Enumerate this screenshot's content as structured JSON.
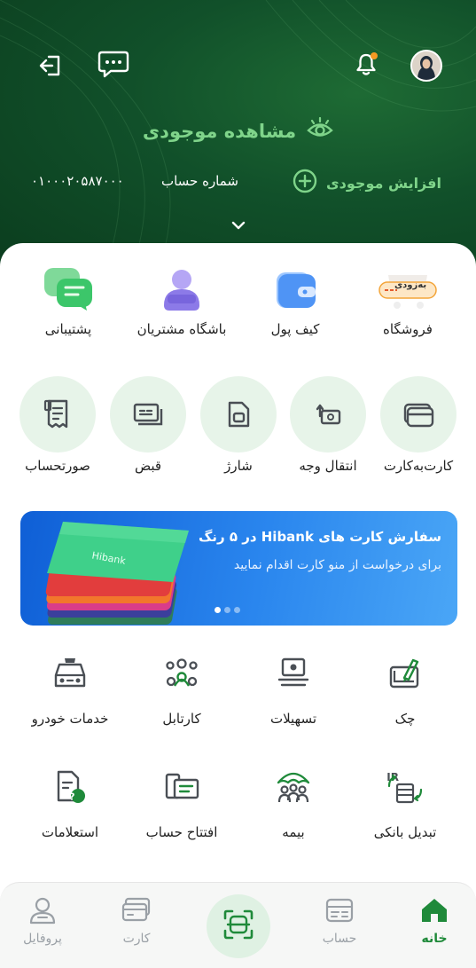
{
  "header": {
    "balance_title": "مشاهده موجودی",
    "account_label": "شماره حساب",
    "account_number": "۰۱۰۰۰۲۰۵۸۷۰۰۰",
    "increase_label": "افزایش موجودی"
  },
  "top_items": [
    {
      "label": "فروشگاه",
      "icon": "shop-icon",
      "badge": "به‌زودی"
    },
    {
      "label": "کیف پول",
      "icon": "wallet-icon"
    },
    {
      "label": "باشگاه مشتریان",
      "icon": "customer-club-icon"
    },
    {
      "label": "پشتیبانی",
      "icon": "support-chat-icon"
    }
  ],
  "circle_items": [
    {
      "label": "کارت‌به‌کارت",
      "icon": "card-to-card-icon"
    },
    {
      "label": "انتقال وجه",
      "icon": "money-transfer-icon"
    },
    {
      "label": "شارژ",
      "icon": "sim-charge-icon"
    },
    {
      "label": "قبض",
      "icon": "bill-icon"
    },
    {
      "label": "صورتحساب",
      "icon": "statement-icon"
    }
  ],
  "banner": {
    "title": "سفارش کارت های Hibank در ۵ رنگ",
    "subtitle": "برای درخواست از منو کارت اقدام نمایید",
    "card_text": "Hibank"
  },
  "services_row1": [
    {
      "label": "چک",
      "icon": "cheque-icon"
    },
    {
      "label": "تسهیلات",
      "icon": "loan-icon"
    },
    {
      "label": "کارتابل",
      "icon": "cartable-icon"
    },
    {
      "label": "خدمات خودرو",
      "icon": "car-services-icon"
    }
  ],
  "services_row2": [
    {
      "label": "تبدیل بانکی",
      "icon": "bank-convert-icon"
    },
    {
      "label": "بیمه",
      "icon": "insurance-icon"
    },
    {
      "label": "افتتاح حساب",
      "icon": "open-account-icon"
    },
    {
      "label": "استعلامات",
      "icon": "inquiry-icon"
    }
  ],
  "nav": {
    "home": "خانه",
    "account": "حساب",
    "card": "کارت",
    "profile": "پروفایل"
  },
  "colors": {
    "brand_green": "#1f8a3a",
    "light_green": "#7fd48a",
    "header_dark": "#0b3d1e",
    "banner_blue": "#2a86ee"
  }
}
